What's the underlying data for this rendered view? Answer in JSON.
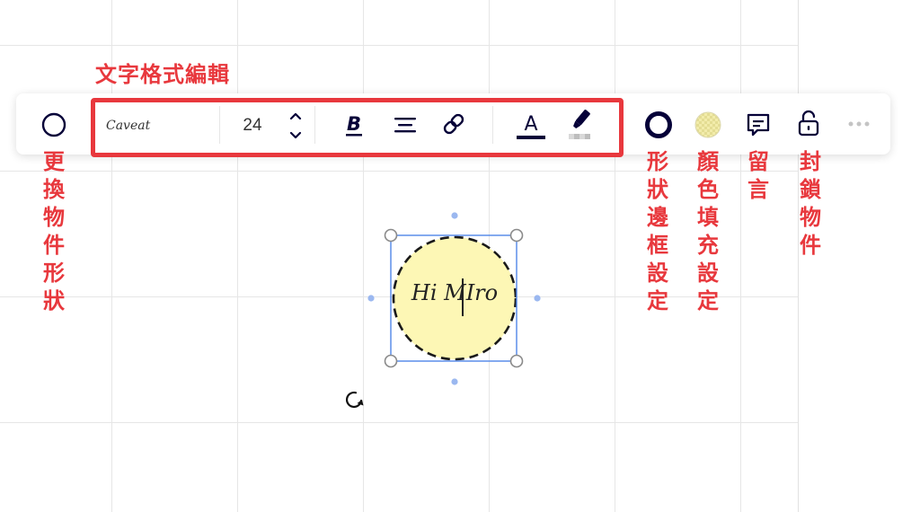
{
  "annotations": {
    "text_format": "文字格式編輯",
    "change_shape": "更換物件形狀",
    "border_setting": "形狀邊框設定",
    "fill_setting": "顏色填充設定",
    "comment": "留言",
    "lock": "封鎖物件"
  },
  "toolbar": {
    "font_family": "Caveat",
    "font_size": "24",
    "shape_icon": "circle-outline-icon",
    "bold_icon": "bold-icon",
    "align_icon": "align-center-icon",
    "link_icon": "link-icon",
    "text_color_icon": "text-color-icon",
    "highlight_icon": "highlighter-icon",
    "border_icon": "border-circle-icon",
    "fill_icon": "fill-color-icon",
    "comment_icon": "comment-icon",
    "lock_icon": "lock-icon",
    "more_icon": "more-icon"
  },
  "canvas": {
    "shape_text": "Hi MIro",
    "fill_color": "#fdf7b5",
    "border_color": "#1a1a1a",
    "selection_color": "#4f86e8",
    "annotation_color": "#e8383d"
  }
}
